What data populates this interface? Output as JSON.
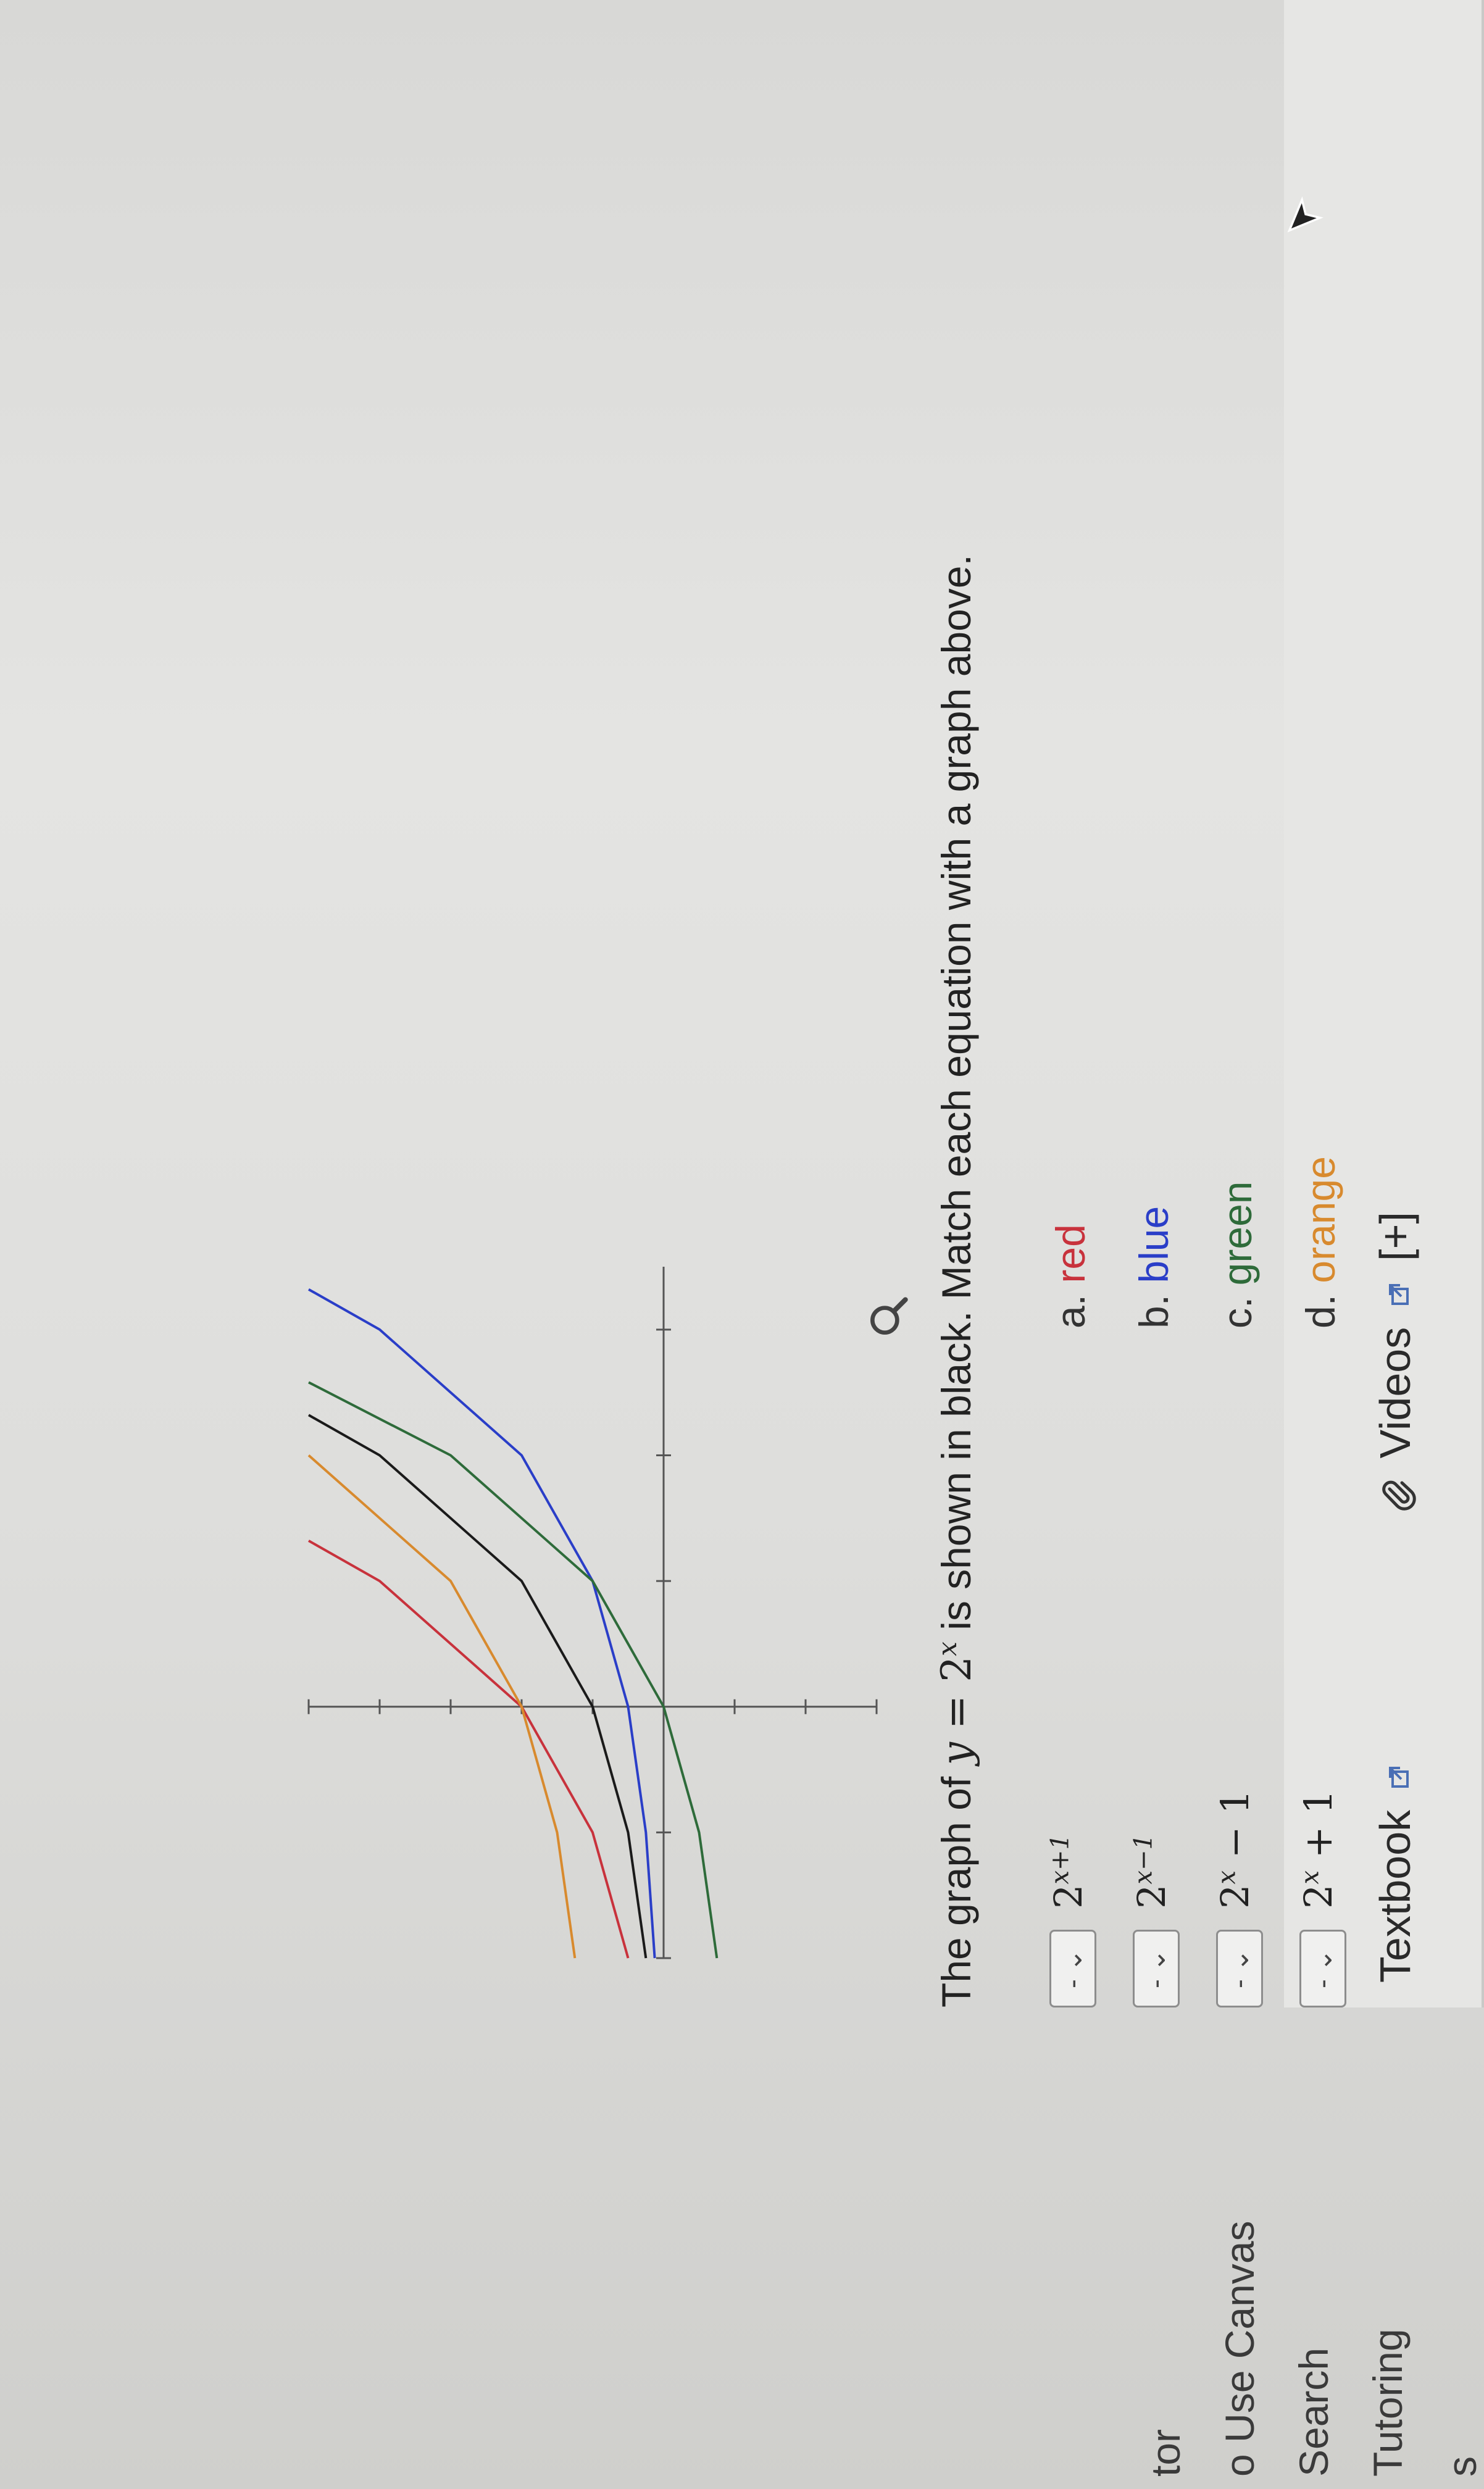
{
  "sidebar": {
    "items": [
      {
        "label": "s"
      },
      {
        "label": "Tutoring"
      },
      {
        "label": "Search"
      },
      {
        "label": "o Use Canvas"
      },
      {
        "label": "tor"
      }
    ]
  },
  "toolbar": {
    "textbook_label": "Textbook",
    "videos_label": "Videos",
    "expand_label": "[+]"
  },
  "question": {
    "prefix": "The graph of ",
    "var_y": "y",
    "equals": " = 2",
    "exponent": "x",
    "suffix": " is shown in black. Match each equation with a graph above."
  },
  "matching": [
    {
      "selected": "- ⌄",
      "equation_base": "2",
      "equation_exp": "x+1",
      "equation_tail": ""
    },
    {
      "selected": "- ⌄",
      "equation_base": "2",
      "equation_exp": "x−1",
      "equation_tail": ""
    },
    {
      "selected": "- ⌄",
      "equation_base": "2",
      "equation_exp": "x",
      "equation_tail": " − 1"
    },
    {
      "selected": "- ⌄",
      "equation_base": "2",
      "equation_exp": "x",
      "equation_tail": " + 1"
    }
  ],
  "choices": [
    {
      "letter": "a. ",
      "name": "red",
      "color": "#c8323c"
    },
    {
      "letter": "b. ",
      "name": "blue",
      "color": "#2a3ec8"
    },
    {
      "letter": "c. ",
      "name": "green",
      "color": "#2e6b3a"
    },
    {
      "letter": "d. ",
      "name": "orange",
      "color": "#d88a2e"
    }
  ],
  "chart_data": {
    "type": "line",
    "title": "",
    "xlabel": "",
    "ylabel": "",
    "xlim": [
      -2,
      3.5
    ],
    "ylim": [
      -3,
      5
    ],
    "grid": false,
    "series": [
      {
        "color": "#1a1a1a",
        "x": [
          -2,
          -1,
          0,
          1,
          2,
          2.32
        ],
        "y": [
          0.25,
          0.5,
          1,
          2,
          4,
          5
        ]
      },
      {
        "color": "#c8323c",
        "x": [
          -2,
          -1,
          0,
          1,
          1.32
        ],
        "y": [
          0.5,
          1,
          2,
          4,
          5
        ]
      },
      {
        "color": "#2a3ec8",
        "x": [
          -2,
          -1,
          0,
          1,
          2,
          3,
          3.32
        ],
        "y": [
          0.125,
          0.25,
          0.5,
          1,
          2,
          4,
          5
        ]
      },
      {
        "color": "#2e6b3a",
        "x": [
          -2,
          -1,
          0,
          1,
          2,
          2.58
        ],
        "y": [
          -0.75,
          -0.5,
          0,
          1,
          3,
          5
        ]
      },
      {
        "color": "#d88a2e",
        "x": [
          -2,
          -1,
          0,
          1,
          2
        ],
        "y": [
          1.25,
          1.5,
          2,
          3,
          5
        ]
      }
    ]
  },
  "colors": {
    "black": "#1a1a1a",
    "red": "#c8323c",
    "blue": "#2a3ec8",
    "green": "#2e6b3a",
    "orange": "#d88a2e"
  }
}
